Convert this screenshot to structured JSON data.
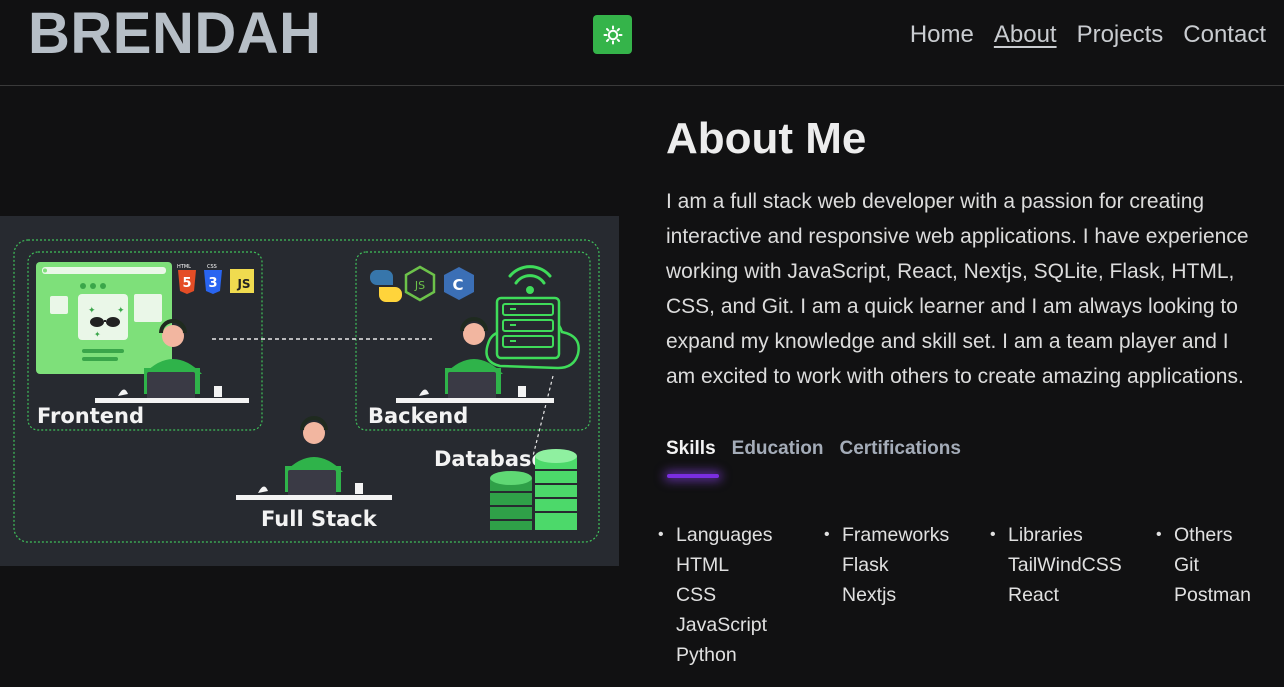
{
  "brand": "BRENDAH",
  "theme_toggle_icon": "sun-icon",
  "nav": {
    "items": [
      {
        "label": "Home"
      },
      {
        "label": "About"
      },
      {
        "label": "Projects"
      },
      {
        "label": "Contact"
      }
    ],
    "active": "About"
  },
  "illustration": {
    "frontend_label": "Frontend",
    "backend_label": "Backend",
    "fullstack_label": "Full Stack",
    "database_label": "Database",
    "js_badge": "JS",
    "html_badge": "HTML",
    "css_badge": "CSS",
    "html_number": "5",
    "css_number": "3",
    "node_badge": "JS",
    "c_badge": "C"
  },
  "about": {
    "title": "About Me",
    "lines": [
      "I am a full stack web developer with a passion for creating",
      "interactive and responsive web applications. I have experience",
      "working with JavaScript, React, Nextjs, SQLite, Flask, HTML,",
      "CSS, and Git. I am a quick learner and I am always looking to",
      "expand my knowledge and skill set. I am a team player and I",
      "am excited to work with others to create amazing applications."
    ]
  },
  "tabs": [
    {
      "label": "Skills",
      "active": true
    },
    {
      "label": "Education",
      "active": false
    },
    {
      "label": "Certifications",
      "active": false
    }
  ],
  "skills": [
    {
      "category": "Languages",
      "items": [
        "HTML",
        "CSS",
        "JavaScript",
        "Python"
      ]
    },
    {
      "category": "Frameworks",
      "items": [
        "Flask",
        "Nextjs"
      ]
    },
    {
      "category": "Libraries",
      "items": [
        "TailWindCSS",
        "React"
      ]
    },
    {
      "category": "Others",
      "items": [
        "Git",
        "Postman"
      ]
    }
  ],
  "colors": {
    "background": "#111112",
    "accent_green": "#35b44a",
    "tab_underline": "#7a2ee0",
    "logo": "#b6bec6"
  }
}
